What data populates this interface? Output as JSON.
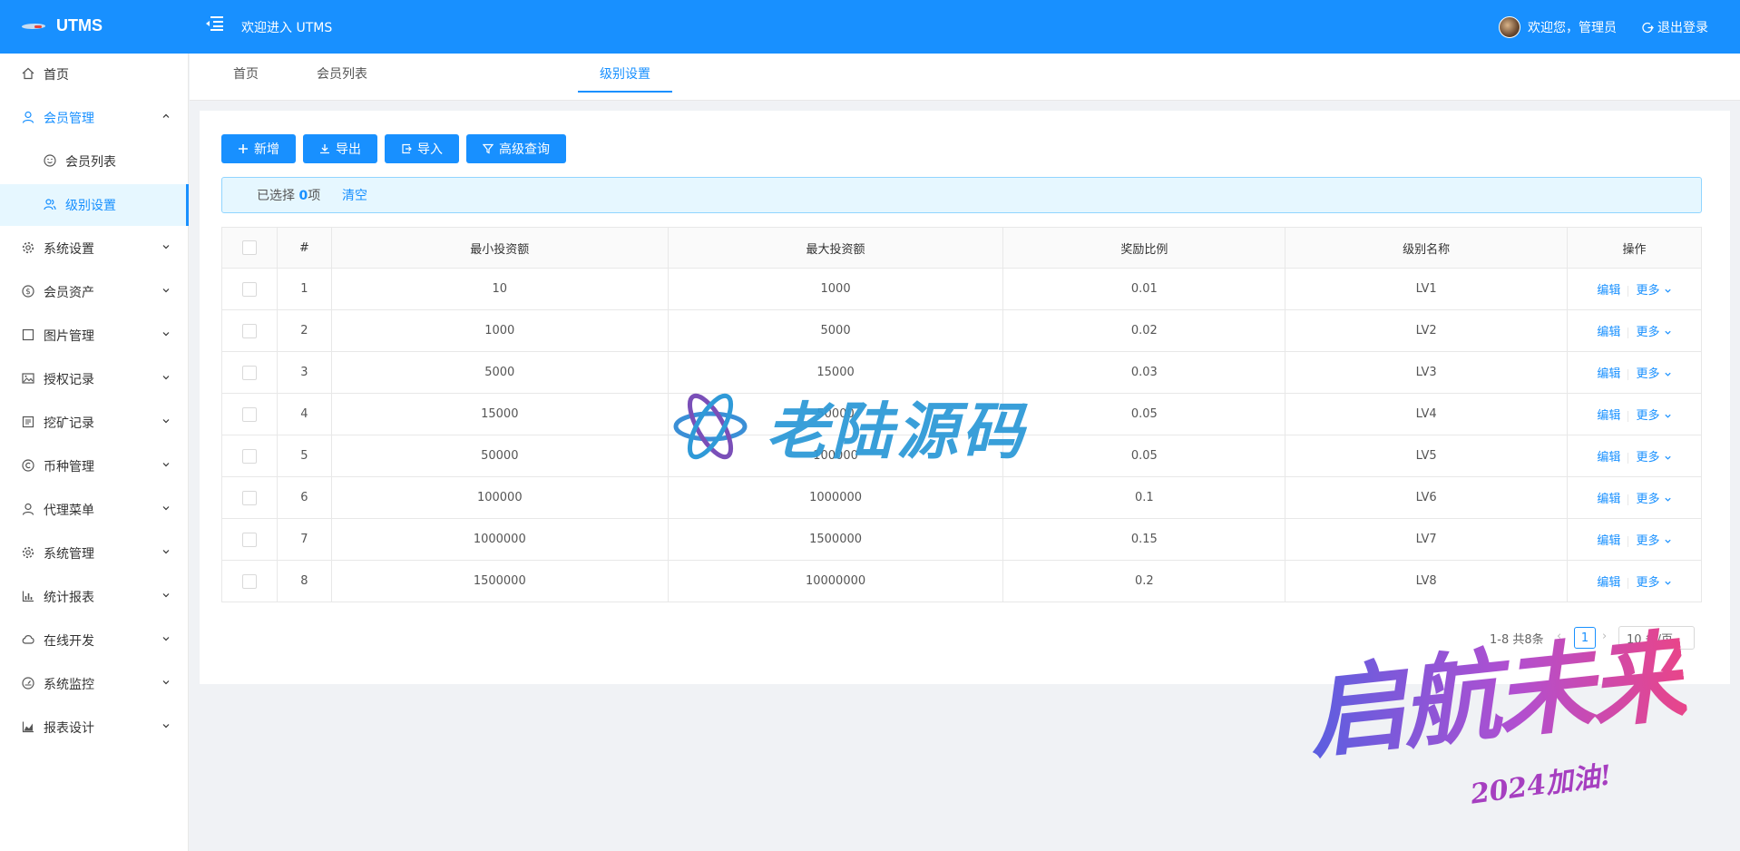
{
  "app": {
    "logo_text": "UTMS",
    "welcome": "欢迎进入 UTMS"
  },
  "user": {
    "greeting": "欢迎您，管理员",
    "logout": "退出登录"
  },
  "sidebar": {
    "items": [
      {
        "label": "首页",
        "icon": "home-icon"
      },
      {
        "label": "会员管理",
        "icon": "user-icon"
      },
      {
        "label": "会员列表",
        "icon": "smile-icon"
      },
      {
        "label": "级别设置",
        "icon": "team-icon"
      },
      {
        "label": "系统设置",
        "icon": "gear-icon"
      },
      {
        "label": "会员资产",
        "icon": "dollar-icon"
      },
      {
        "label": "图片管理",
        "icon": "square-icon"
      },
      {
        "label": "授权记录",
        "icon": "picture-icon"
      },
      {
        "label": "挖矿记录",
        "icon": "profile-icon"
      },
      {
        "label": "币种管理",
        "icon": "copyright-icon"
      },
      {
        "label": "代理菜单",
        "icon": "user-icon"
      },
      {
        "label": "系统管理",
        "icon": "gear-icon"
      },
      {
        "label": "统计报表",
        "icon": "bar-chart-icon"
      },
      {
        "label": "在线开发",
        "icon": "cloud-icon"
      },
      {
        "label": "系统监控",
        "icon": "dashboard-icon"
      },
      {
        "label": "报表设计",
        "icon": "area-chart-icon"
      }
    ]
  },
  "tabs": [
    {
      "label": "首页"
    },
    {
      "label": "会员列表"
    },
    {
      "label": "级别设置",
      "active": true
    }
  ],
  "toolbar": {
    "add": "新增",
    "export": "导出",
    "import": "导入",
    "advanced_query": "高级查询"
  },
  "selection": {
    "prefix": "已选择 ",
    "count": "0",
    "suffix": "项",
    "clear": "清空"
  },
  "table": {
    "columns": [
      "#",
      "最小投资额",
      "最大投资额",
      "奖励比例",
      "级别名称",
      "操作"
    ],
    "rows": [
      [
        "1",
        "10",
        "1000",
        "0.01",
        "LV1"
      ],
      [
        "2",
        "1000",
        "5000",
        "0.02",
        "LV2"
      ],
      [
        "3",
        "5000",
        "15000",
        "0.03",
        "LV3"
      ],
      [
        "4",
        "15000",
        "50000",
        "0.05",
        "LV4"
      ],
      [
        "5",
        "50000",
        "100000",
        "0.05",
        "LV5"
      ],
      [
        "6",
        "100000",
        "1000000",
        "0.1",
        "LV6"
      ],
      [
        "7",
        "1000000",
        "1500000",
        "0.15",
        "LV7"
      ],
      [
        "8",
        "1500000",
        "10000000",
        "0.2",
        "LV8"
      ]
    ],
    "action_edit": "编辑",
    "action_more": "更多"
  },
  "pagination": {
    "total": "1-8 共8条",
    "current": "1",
    "page_size": "10 条/页"
  },
  "watermark": {
    "brand": "老陆源码",
    "slogan": "启航未来",
    "slogan_sub": "2024加油!"
  },
  "colors": {
    "primary": "#1890ff",
    "background": "#f0f2f5"
  }
}
